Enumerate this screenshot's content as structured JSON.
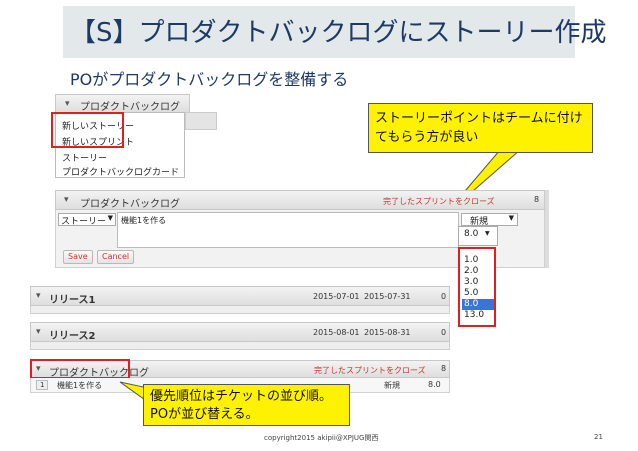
{
  "slide": {
    "title": "【S】プロダクトバックログにストーリー作成",
    "subtitle": "POがプロダクトバックログを整備する",
    "footer": "copyright2015 akipii@XPJUG関西",
    "page_number": "21"
  },
  "menu_panel": {
    "header": "プロダクトバックログ",
    "items": [
      "新しいストーリー",
      "新しいスプリント",
      "ストーリー",
      "プロダクトバックログカード"
    ]
  },
  "callouts": {
    "story_point": "ストーリーポイントはチームに付けてもらう方が良い",
    "priority": "優先順位はチケットの並び順。POが並び替える。"
  },
  "edit_panel": {
    "header": "プロダクトバックログ",
    "close_link": "完了したスプリントをクローズ",
    "count": "8",
    "type_select": "ストーリー",
    "subject_value": "機能1を作る",
    "status_select": "新規",
    "points_select": "8.0",
    "save_label": "Save",
    "cancel_label": "Cancel",
    "point_options": [
      "1.0",
      "2.0",
      "3.0",
      "5.0",
      "8.0",
      "13.0"
    ],
    "selected_point": "8.0"
  },
  "releases": [
    {
      "name": "リリース1",
      "start": "2015-07-01",
      "end": "2015-07-31",
      "count": "0"
    },
    {
      "name": "リリース2",
      "start": "2015-08-01",
      "end": "2015-08-31",
      "count": "0"
    }
  ],
  "backlog_panel": {
    "header": "プロダクトバックログ",
    "close_link": "完了したスプリントをクローズ",
    "count": "8",
    "row": {
      "id": "1",
      "subject": "機能1を作る",
      "status": "新規",
      "points": "8.0"
    }
  },
  "colors": {
    "callout_bg": "#fff200",
    "highlight": "#e02020",
    "title_text": "#1d3a66",
    "link": "#c0392b",
    "selected_option": "#3875d7"
  }
}
